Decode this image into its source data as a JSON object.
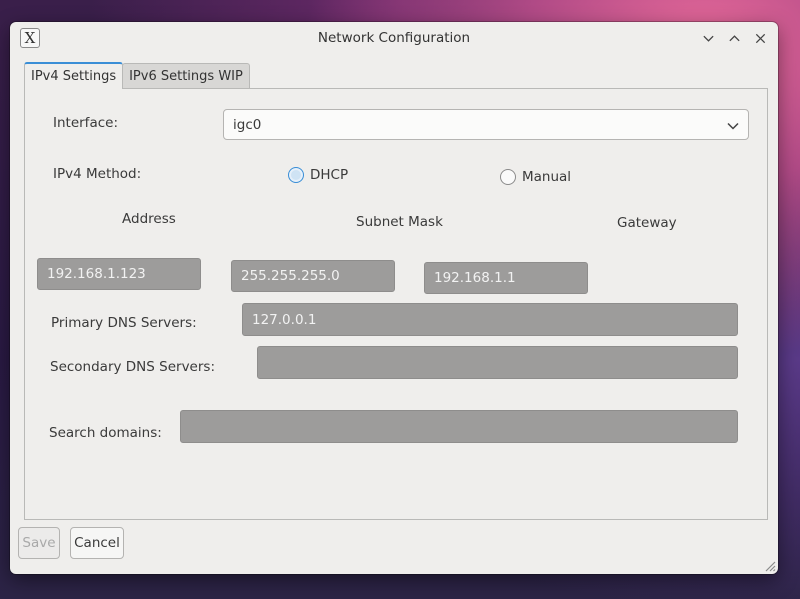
{
  "window": {
    "title": "Network Configuration",
    "app_icon_glyph": "X"
  },
  "tabs": [
    {
      "label": "IPv4 Settings",
      "active": true
    },
    {
      "label": "IPv6 Settings WIP",
      "active": false
    }
  ],
  "form": {
    "interface_label": "Interface:",
    "interface_value": "igc0",
    "method_label": "IPv4 Method:",
    "method_options": [
      {
        "label": "DHCP",
        "selected": true
      },
      {
        "label": "Manual",
        "selected": false
      }
    ],
    "address_label": "Address",
    "subnet_label": "Subnet Mask",
    "gateway_label": "Gateway",
    "address_value": "192.168.1.123",
    "subnet_value": "255.255.255.0",
    "gateway_value": "192.168.1.1",
    "primary_dns_label": "Primary DNS Servers:",
    "primary_dns_value": "127.0.0.1",
    "secondary_dns_label": "Secondary DNS Servers:",
    "secondary_dns_value": "",
    "search_domains_label": "Search domains:",
    "search_domains_value": ""
  },
  "buttons": {
    "save": "Save",
    "cancel": "Cancel"
  },
  "colors": {
    "accent": "#3a8ed6",
    "disabled_field": "#9d9c9b",
    "window_bg": "#efeeec"
  }
}
